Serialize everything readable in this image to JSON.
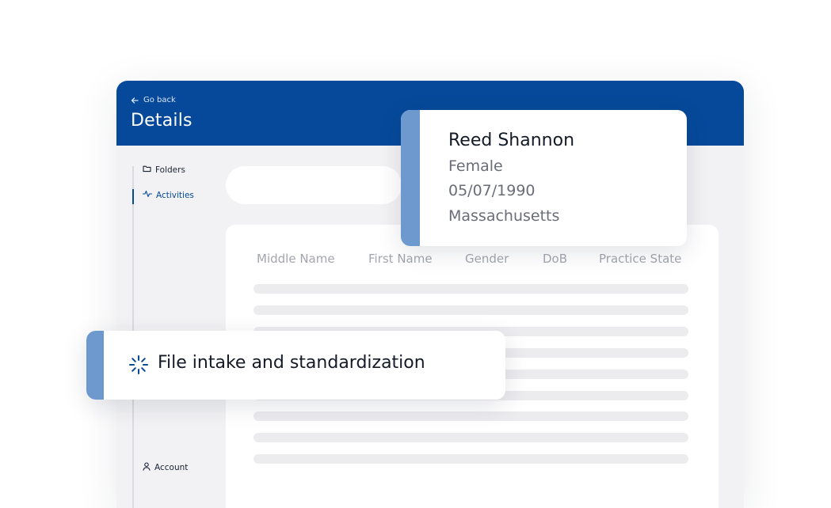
{
  "header": {
    "back_label": "Go back",
    "title": "Details"
  },
  "sidebar": {
    "items": [
      {
        "label": "Folders",
        "icon": "folder-icon",
        "active": false
      },
      {
        "label": "Activities",
        "icon": "activity-icon",
        "active": true
      }
    ],
    "account": {
      "label": "Account",
      "icon": "user-icon"
    }
  },
  "table": {
    "columns": [
      "Middle Name",
      "First Name",
      "Gender",
      "DoB",
      "Practice State"
    ],
    "placeholder_rows": 9
  },
  "person_card": {
    "name": "Reed Shannon",
    "gender": "Female",
    "dob": "05/07/1990",
    "state": "Massachusetts"
  },
  "task_card": {
    "icon": "loading-spinner-icon",
    "label": "File intake and standardization"
  },
  "colors": {
    "header": "#06499a",
    "accent": "#6e99cf",
    "panel_background": "#f2f2f4"
  }
}
